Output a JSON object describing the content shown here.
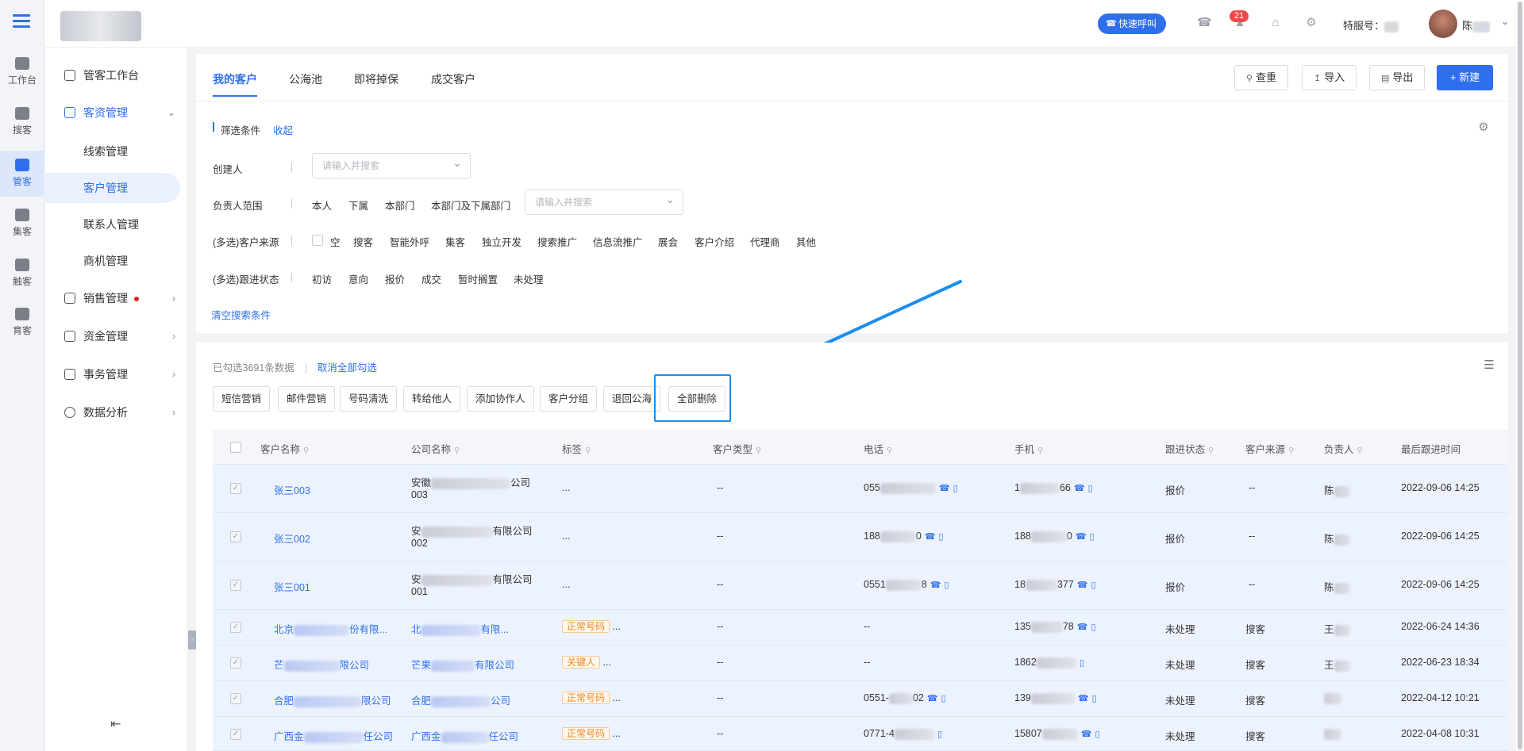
{
  "rail": [
    {
      "label": "工作台",
      "icon": "monitor-icon"
    },
    {
      "label": "搜客",
      "icon": "search-user-icon"
    },
    {
      "label": "管客",
      "icon": "cloud-icon",
      "active": true
    },
    {
      "label": "集客",
      "icon": "group-icon"
    },
    {
      "label": "触客",
      "icon": "headset-icon"
    },
    {
      "label": "育客",
      "icon": "people-icon"
    }
  ],
  "nav": {
    "workbench": "管客工作台",
    "customer_mgmt": "客资管理",
    "sub": [
      "线索管理",
      "客户管理",
      "联系人管理",
      "商机管理"
    ],
    "sales": "销售管理",
    "funds": "资金管理",
    "affairs": "事务管理",
    "analytics": "数据分析"
  },
  "topbar": {
    "call_button": "快速呼叫",
    "notification_count": "21",
    "phone_label": "特服号：",
    "user_name": "陈"
  },
  "tabs": [
    "我的客户",
    "公海池",
    "即将掉保",
    "成交客户"
  ],
  "toolbar": {
    "check": "查重",
    "import": "导入",
    "export": "导出",
    "new": "+ 新建"
  },
  "filter": {
    "title": "筛选条件",
    "collapse": "收起",
    "creator_label": "创建人",
    "search_placeholder": "请输入并搜索",
    "owner_label": "负责人范围",
    "owner_options": [
      "本人",
      "下属",
      "本部门",
      "本部门及下属部门"
    ],
    "source_label": "(多选)客户来源",
    "source_options": [
      "空",
      "搜客",
      "智能外呼",
      "集客",
      "独立开发",
      "搜索推广",
      "信息流推广",
      "展会",
      "客户介绍",
      "代理商",
      "其他"
    ],
    "status_label": "(多选)跟进状态",
    "status_options": [
      "初访",
      "意向",
      "报价",
      "成交",
      "暂时搁置",
      "未处理"
    ],
    "clear": "清空搜索条件"
  },
  "selection": {
    "info": "已勾选3691条数据",
    "cancel": "取消全部勾选"
  },
  "actions": [
    "短信营销",
    "邮件营销",
    "号码清洗",
    "转给他人",
    "添加协作人",
    "客户分组",
    "退回公海",
    "全部删除"
  ],
  "columns": [
    "客户名称",
    "公司名称",
    "标签",
    "客户类型",
    "电话",
    "手机",
    "跟进状态",
    "客户来源",
    "负责人",
    "最后跟进时间"
  ],
  "rows": [
    {
      "name": "张三003",
      "company_a": "安徽",
      "company_b": "公司",
      "company_c": "003",
      "tag": "...",
      "type": "--",
      "tel": "055",
      "mobile_a": "1",
      "mobile_b": "66",
      "status": "报价",
      "source": "--",
      "owner": "陈",
      "time": "2022-09-06 14:25"
    },
    {
      "name": "张三002",
      "company_a": "安",
      "company_b": "有限公司",
      "company_c": "002",
      "tag": "...",
      "type": "--",
      "tel": "188",
      "tel_b": "0",
      "mobile_a": "188",
      "mobile_b": "0",
      "status": "报价",
      "source": "--",
      "owner": "陈",
      "time": "2022-09-06 14:25"
    },
    {
      "name": "张三001",
      "company_a": "安",
      "company_b": "有限公司",
      "company_c": "001",
      "tag": "...",
      "type": "--",
      "tel": "0551",
      "tel_b": "8",
      "mobile_a": "18",
      "mobile_b": "377",
      "status": "报价",
      "source": "--",
      "owner": "陈",
      "time": "2022-09-06 14:25"
    },
    {
      "name_a": "北京",
      "name_b": "份有限...",
      "comp_a": "北",
      "comp_b": "有限...",
      "tag": "正常号码",
      "type": "--",
      "tel": "--",
      "mobile_a": "135",
      "mobile_b": "78",
      "status": "未处理",
      "source": "搜客",
      "owner": "王",
      "time": "2022-06-24 14:36"
    },
    {
      "name_a": "芒",
      "name_b": "限公司",
      "comp_a": "芒果",
      "comp_b": "有限公司",
      "tag": "关键人",
      "type": "--",
      "tel": "--",
      "mobile_a": "1862",
      "status": "未处理",
      "source": "搜客",
      "owner": "王",
      "time": "2022-06-23 18:34"
    },
    {
      "name_a": "合肥",
      "name_b": "限公司",
      "comp_a": "合肥",
      "comp_b": "公司",
      "tag": "正常号码",
      "type": "--",
      "tel": "0551-",
      "tel_b": "02",
      "mobile_a": "139",
      "status": "未处理",
      "source": "搜客",
      "owner": "",
      "time": "2022-04-12 10:21"
    },
    {
      "name_a": "广西金",
      "name_b": "任公司",
      "comp_a": "广西金",
      "comp_b": "任公司",
      "tag": "正常号码",
      "type": "--",
      "tel": "0771-4",
      "mobile_a": "15807",
      "status": "未处理",
      "source": "搜客",
      "owner": "",
      "time": "2022-04-08 10:31"
    }
  ]
}
